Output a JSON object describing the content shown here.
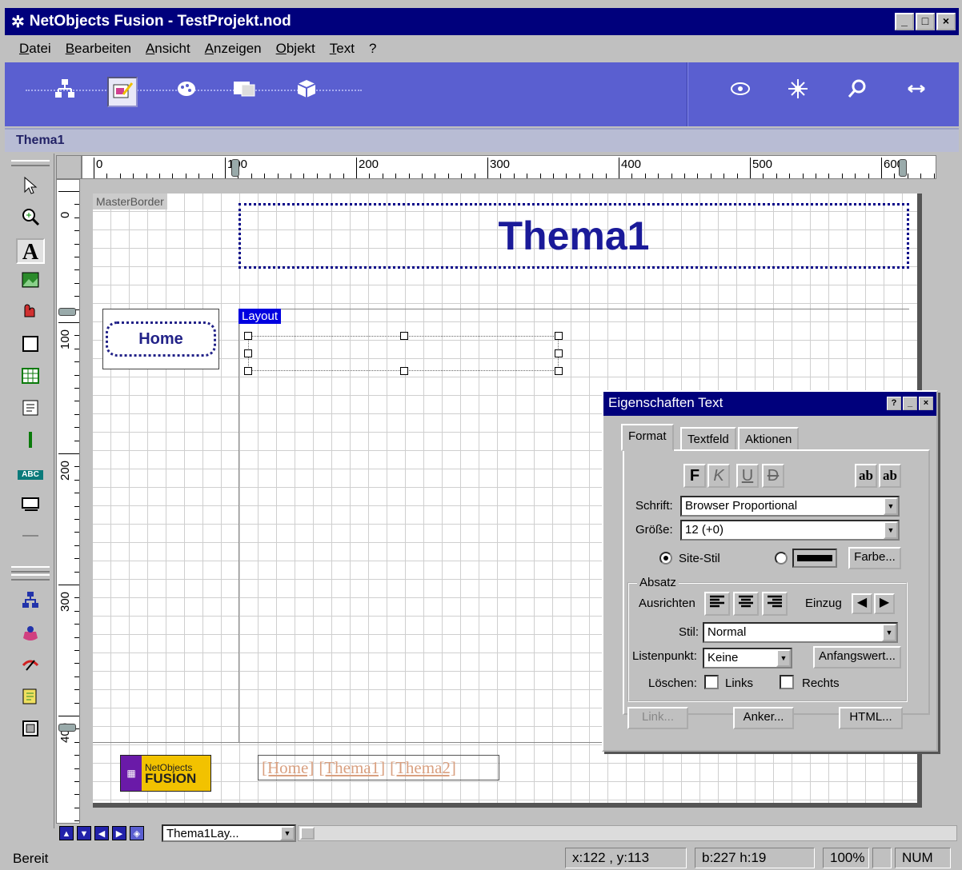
{
  "window": {
    "title": "NetObjects Fusion - TestProjekt.nod",
    "app_icon": "asterisk-app-icon",
    "controls": [
      "_",
      "□",
      "×"
    ]
  },
  "menubar": [
    "Datei",
    "Bearbeiten",
    "Ansicht",
    "Anzeigen",
    "Objekt",
    "Text",
    "?"
  ],
  "toolbar": {
    "left": [
      "site-view-icon",
      "page-view-icon",
      "style-view-icon",
      "assets-view-icon",
      "publish-view-icon"
    ],
    "right": [
      "preview-icon",
      "spark-icon",
      "zoom-icon",
      "arrows-icon"
    ]
  },
  "breadcrumb": "Thema1",
  "ruler": {
    "h_labels": [
      "0",
      "100",
      "200",
      "300",
      "400",
      "500",
      "600"
    ],
    "v_labels": [
      "0",
      "100",
      "200",
      "300",
      "400"
    ]
  },
  "page": {
    "masterborder_label": "MasterBorder",
    "banner_title": "Thema1",
    "layout_label": "Layout",
    "home_button": "Home",
    "logo": {
      "line1": "NetObjects",
      "line2": "FUSION"
    },
    "navbar": [
      "[Home]",
      "[Thema1]",
      "[Thema2]"
    ]
  },
  "pagenav": {
    "page_select": "Thema1Lay..."
  },
  "statusbar": {
    "status": "Bereit",
    "coords": "x:122 , y:113",
    "size": "b:227 h:19",
    "zoom": "100%",
    "num": "NUM"
  },
  "dialog": {
    "title": "Eigenschaften Text",
    "tabs": [
      "Format",
      "Textfeld",
      "Aktionen"
    ],
    "style_buttons": [
      "F",
      "K",
      "U",
      "D"
    ],
    "superscript": "ab",
    "subscript": "ab",
    "font_label": "Schrift:",
    "font_value": "Browser Proportional",
    "size_label": "Größe:",
    "size_value": "12 (+0)",
    "site_style_label": "Site-Stil",
    "color_button": "Farbe...",
    "paragraph_group": "Absatz",
    "align_label": "Ausrichten",
    "indent_label": "Einzug",
    "style_label": "Stil:",
    "style_value": "Normal",
    "bullet_label": "Listenpunkt:",
    "bullet_value": "Keine",
    "start_value_button": "Anfangswert...",
    "clear_label": "Löschen:",
    "clear_left": "Links",
    "clear_right": "Rechts",
    "link_button": "Link...",
    "anchor_button": "Anker...",
    "html_button": "HTML..."
  }
}
